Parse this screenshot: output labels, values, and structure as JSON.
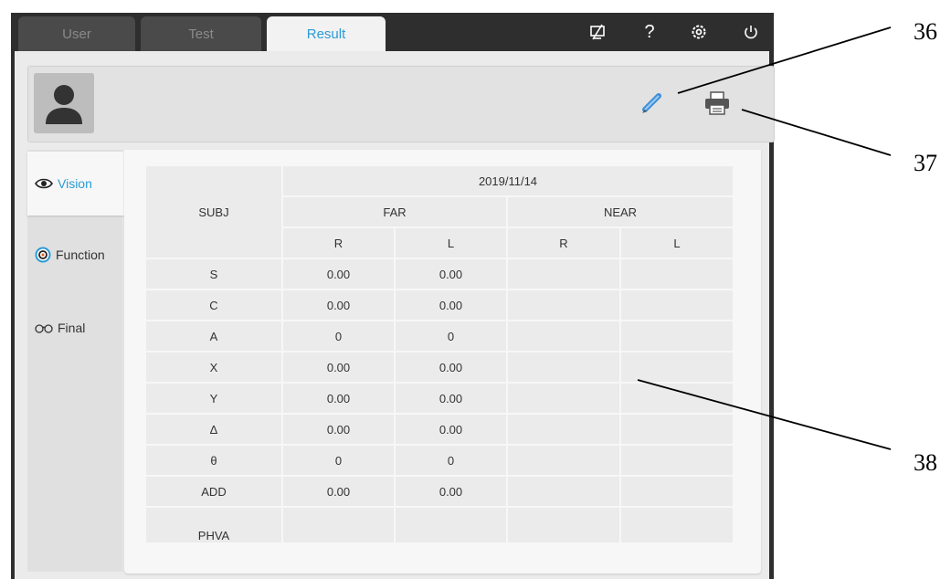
{
  "tabs": [
    {
      "label": "User"
    },
    {
      "label": "Test"
    },
    {
      "label": "Result"
    }
  ],
  "top_icons": [
    "display-off-icon",
    "help-icon",
    "settings-icon",
    "power-icon"
  ],
  "top_icon_glyphs": {
    "help": "?"
  },
  "sidebar": {
    "items": [
      {
        "label": "Vision",
        "icon": "eye-icon"
      },
      {
        "label": "Function",
        "icon": "target-icon"
      },
      {
        "label": "Final",
        "icon": "glasses-icon"
      }
    ]
  },
  "table": {
    "date": "2019/11/14",
    "subj_label": "SUBJ",
    "far_label": "FAR",
    "near_label": "NEAR",
    "r_label": "R",
    "l_label": "L",
    "rows": [
      {
        "label": "S",
        "far_r": "0.00",
        "far_l": "0.00"
      },
      {
        "label": "C",
        "far_r": "0.00",
        "far_l": "0.00"
      },
      {
        "label": "A",
        "far_r": "0",
        "far_l": "0"
      },
      {
        "label": "X",
        "far_r": "0.00",
        "far_l": "0.00"
      },
      {
        "label": "Y",
        "far_r": "0.00",
        "far_l": "0.00"
      },
      {
        "label": "Δ",
        "far_r": "0.00",
        "far_l": "0.00"
      },
      {
        "label": "θ",
        "far_r": "0",
        "far_l": "0"
      },
      {
        "label": "ADD",
        "far_r": "0.00",
        "far_l": "0.00"
      },
      {
        "label": "PHVA",
        "far_r": "",
        "far_l": ""
      }
    ]
  },
  "annotations": [
    "36",
    "37",
    "38"
  ],
  "colors": {
    "accent": "#2a9bd6",
    "far_bg": "#daeaf1",
    "near_bg": "#dcefd6",
    "header_bg": "#bdbdbd",
    "topbar": "#2e2e2e"
  }
}
